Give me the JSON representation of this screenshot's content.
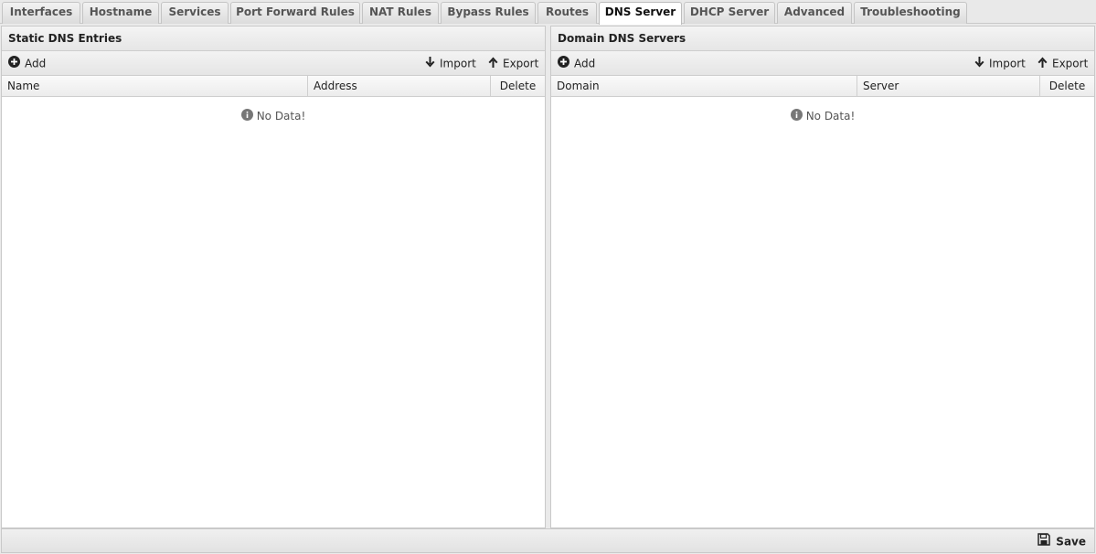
{
  "tabs": [
    {
      "label": "Interfaces"
    },
    {
      "label": "Hostname"
    },
    {
      "label": "Services"
    },
    {
      "label": "Port Forward Rules"
    },
    {
      "label": "NAT Rules"
    },
    {
      "label": "Bypass Rules"
    },
    {
      "label": "Routes"
    },
    {
      "label": "DNS Server",
      "active": true
    },
    {
      "label": "DHCP Server"
    },
    {
      "label": "Advanced"
    },
    {
      "label": "Troubleshooting"
    }
  ],
  "left_panel": {
    "title": "Static DNS Entries",
    "add_label": "Add",
    "import_label": "Import",
    "export_label": "Export",
    "columns": [
      "Name",
      "Address",
      "Delete"
    ],
    "empty_text": "No Data!"
  },
  "right_panel": {
    "title": "Domain DNS Servers",
    "add_label": "Add",
    "import_label": "Import",
    "export_label": "Export",
    "columns": [
      "Domain",
      "Server",
      "Delete"
    ],
    "empty_text": "No Data!"
  },
  "footer": {
    "save_label": "Save"
  },
  "icons": {
    "add": "plus-circle-icon",
    "import": "arrow-down-icon",
    "export": "arrow-up-icon",
    "info": "info-circle-icon",
    "save": "floppy-disk-icon"
  }
}
